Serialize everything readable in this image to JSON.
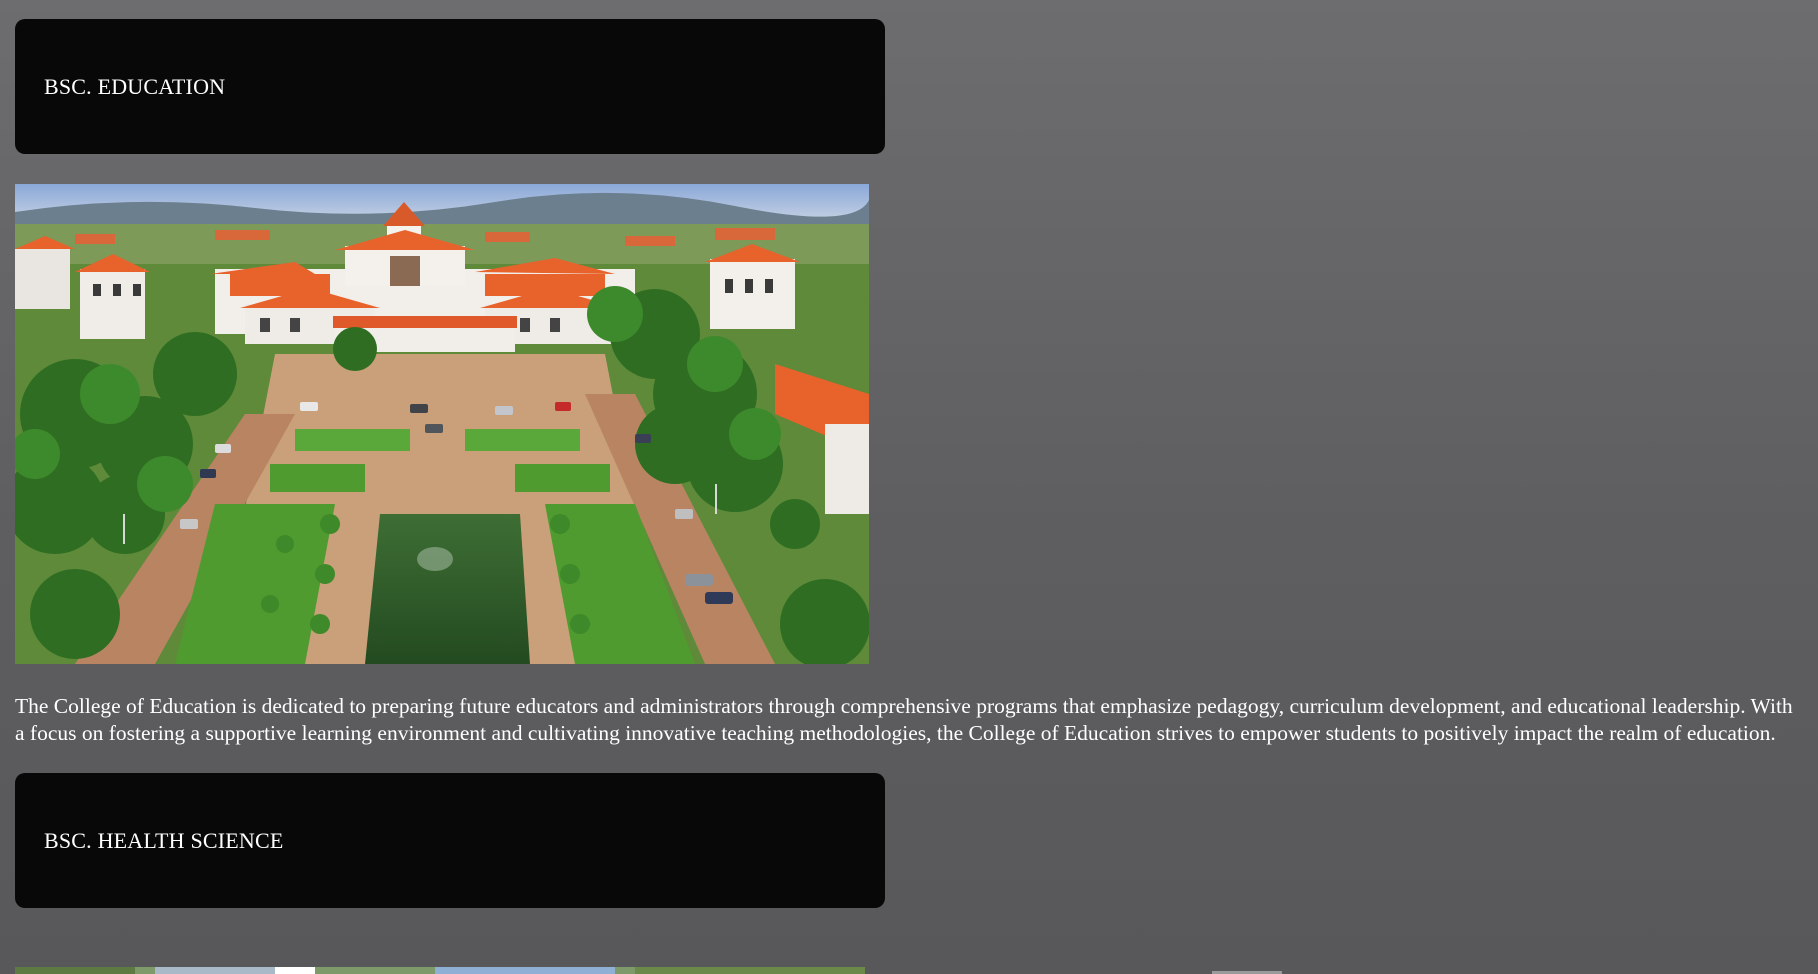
{
  "programs": [
    {
      "title": "BSC. EDUCATION",
      "image_alt": "campus-aerial-photo",
      "description": "The College of Education is dedicated to preparing future educators and administrators through comprehensive programs that emphasize pedagogy, curriculum development, and educational leadership. With a focus on fostering a supportive learning environment and cultivating innovative teaching methodologies, the College of Education strives to empower students to positively impact the realm of education."
    },
    {
      "title": "BSC. HEALTH SCIENCE"
    }
  ],
  "colors": {
    "page_background": "#626264",
    "header_background": "#080808",
    "text": "#ffffff",
    "roof_orange": "#e8622c",
    "lawn_green": "#4f9b2f",
    "pond_green": "#2f5c2a"
  }
}
